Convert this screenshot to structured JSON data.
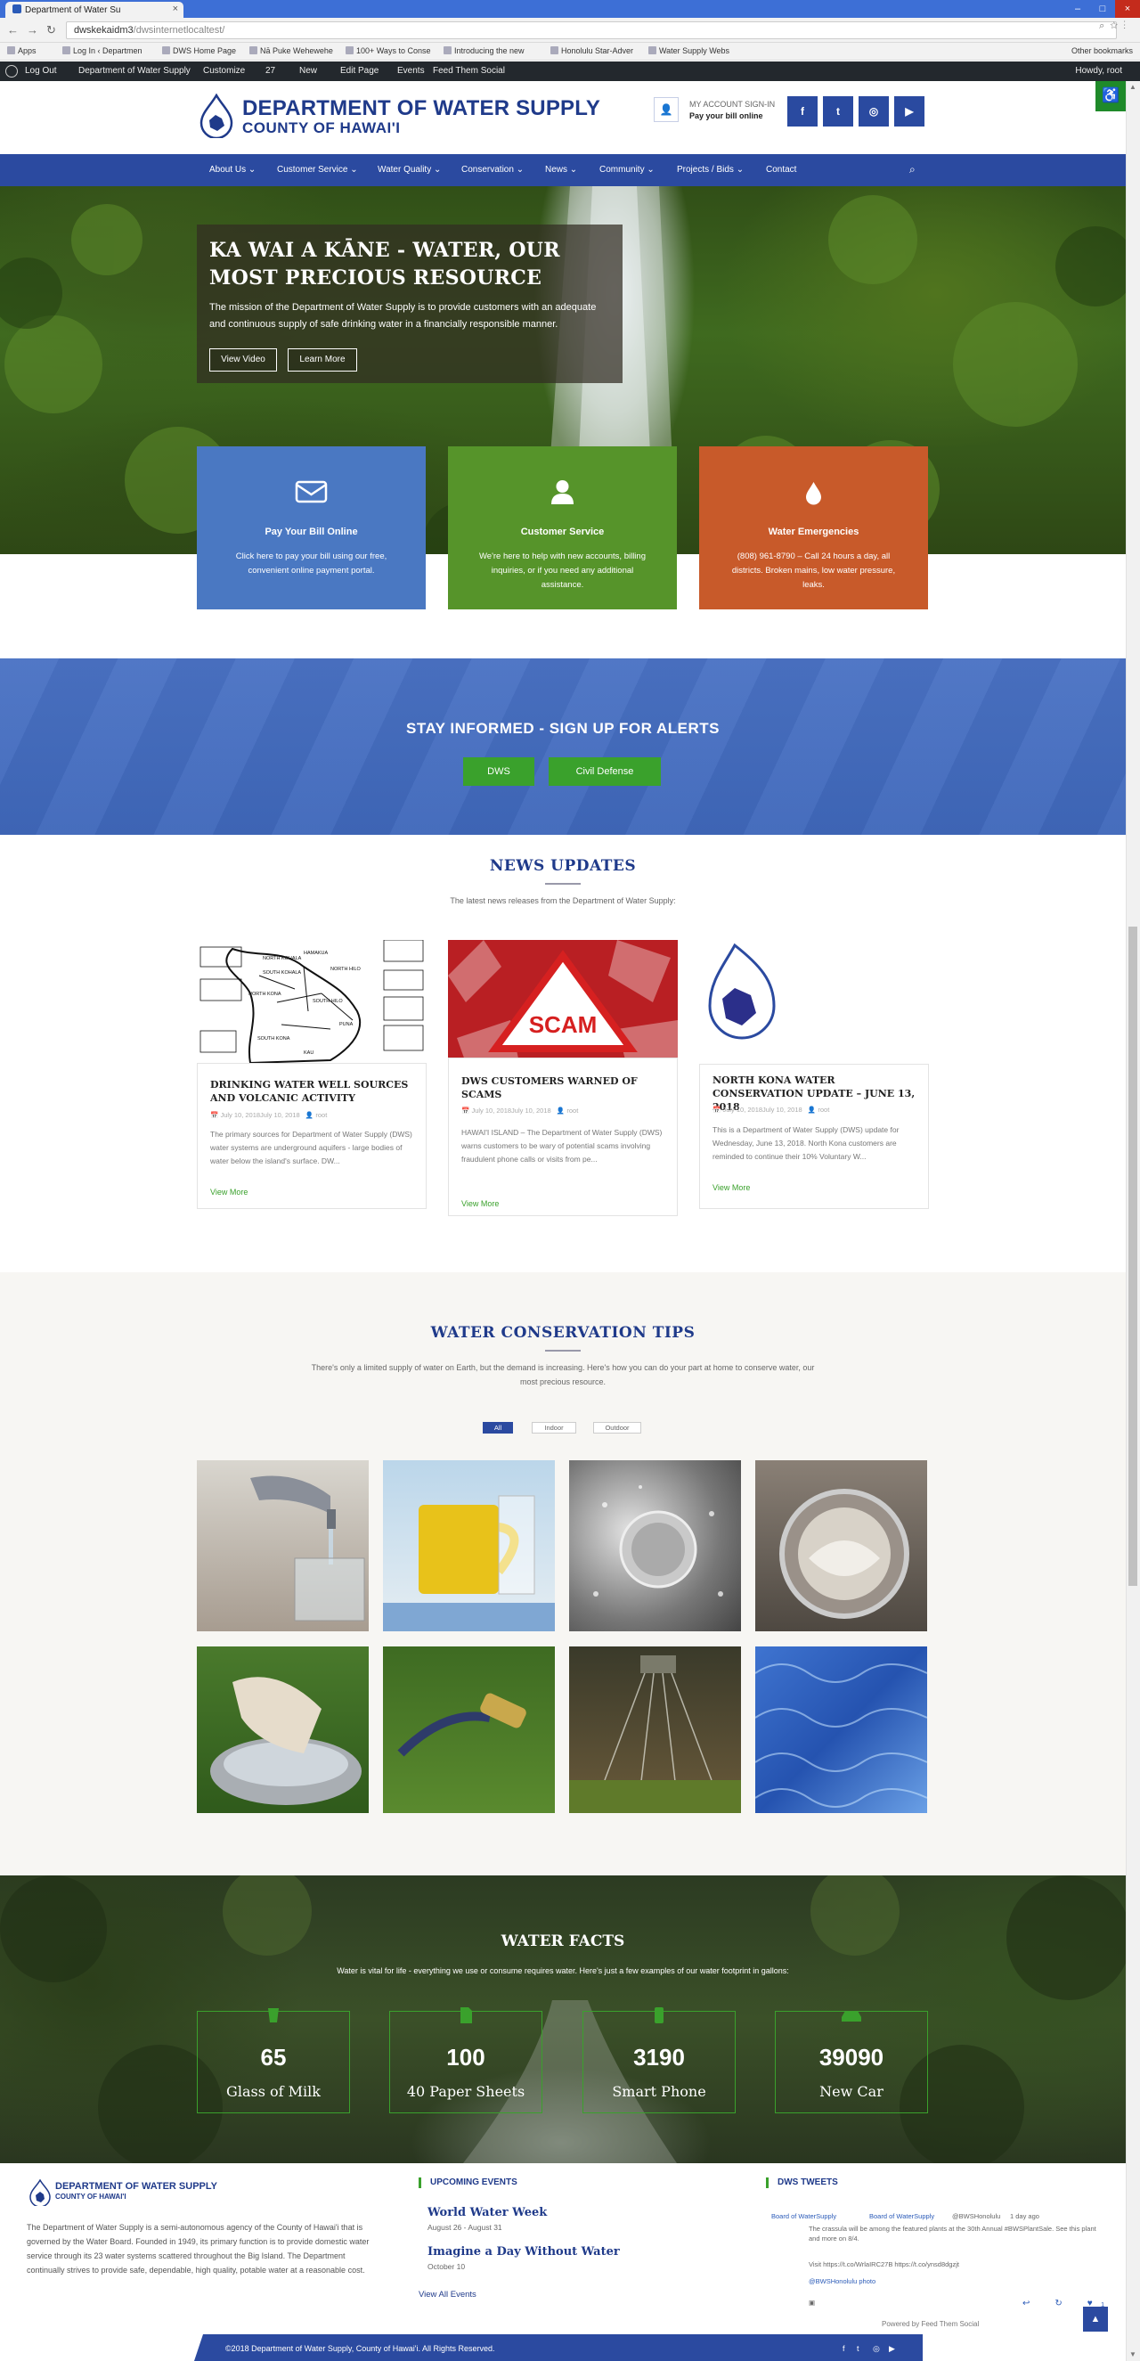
{
  "browser": {
    "tab_title": "Department of Water Su",
    "url_host": "dwskekaidm3",
    "url_path": "/dwsinternetlocaltest/",
    "bookmarks": [
      "Apps",
      "Log In ‹ Departmen",
      "DWS Home Page",
      "Nā Puke Wehewehe",
      "100+ Ways to Conse",
      "Introducing the new",
      "Honolulu Star-Adver",
      "Water Supply Webs"
    ],
    "other_bookmarks": "Other bookmarks"
  },
  "wp_admin": {
    "log_out": "Log Out",
    "site": "Department of Water Supply",
    "customize": "Customize",
    "comments": "27",
    "new": "New",
    "edit_page": "Edit Page",
    "events": "Events",
    "feed": "Feed Them Social",
    "howdy": "Howdy, root"
  },
  "header": {
    "title": "DEPARTMENT OF WATER SUPPLY",
    "subtitle": "COUNTY OF HAWAI'I",
    "account_line1": "MY ACCOUNT SIGN-IN",
    "account_line2": "Pay your bill online",
    "social": [
      "f",
      "t",
      "◎",
      "▶"
    ]
  },
  "nav": {
    "items": [
      "About Us ⌄",
      "Customer Service ⌄",
      "Water Quality ⌄",
      "Conservation ⌄",
      "News ⌄",
      "Community ⌄",
      "Projects / Bids ⌄",
      "Contact"
    ]
  },
  "hero": {
    "title": "KA WAI A KĀNE - WATER, OUR MOST PRECIOUS RESOURCE",
    "text": "The mission of the Department of Water Supply is to provide customers with an adequate and continuous supply of safe drinking water in a financially responsible manner.",
    "btn_video": "View Video",
    "btn_learn": "Learn More"
  },
  "features": [
    {
      "title": "Pay Your Bill Online",
      "text": "Click here to pay your bill using our free, convenient online payment portal.",
      "color": "#4a78c2",
      "icon": "envelope-icon"
    },
    {
      "title": "Customer Service",
      "text": "We're here to help with new accounts, billing inquiries, or if you need any additional assistance.",
      "color": "#56942a",
      "icon": "user-icon"
    },
    {
      "title": "Water Emergencies",
      "text": "(808) 961-8790 – Call 24 hours a day, all districts. Broken mains, low water pressure, leaks.",
      "color": "#c85a2a",
      "icon": "water-drop-icon"
    }
  ],
  "alerts": {
    "title": "STAY INFORMED - SIGN UP FOR ALERTS",
    "btn_dws": "DWS",
    "btn_civil": "Civil Defense"
  },
  "news": {
    "title": "NEWS UPDATES",
    "subtitle": "The latest news releases from the Department of Water Supply:",
    "items": [
      {
        "title": "DRINKING WATER WELL SOURCES AND VOLCANIC ACTIVITY",
        "date": "July 10, 2018July 10, 2018",
        "author": "root",
        "excerpt": "The primary sources for Department of Water Supply (DWS) water systems are underground aquifers - large bodies of water below the island's surface. DW...",
        "more": "View More"
      },
      {
        "title": "DWS CUSTOMERS WARNED OF SCAMS",
        "date": "July 10, 2018July 10, 2018",
        "author": "root",
        "excerpt": "HAWAI'I ISLAND – The Department of Water Supply (DWS) warns customers to be wary of potential scams involving fraudulent phone calls or visits from pe...",
        "more": "View More"
      },
      {
        "title": "NORTH KONA WATER CONSERVATION UPDATE – JUNE 13, 2018",
        "date": "July 10, 2018July 10, 2018",
        "author": "root",
        "excerpt": "This is a Department of Water Supply (DWS) update for Wednesday, June 13, 2018. North Kona customers are reminded to continue their 10% Voluntary W...",
        "more": "View More"
      }
    ],
    "map_labels": [
      "NORTH KOHALA",
      "SOUTH KOHALA",
      "HAMAKUA",
      "NORTH KONA",
      "SOUTH KONA",
      "NORTH HILO",
      "SOUTH HILO",
      "PUNA",
      "KAU"
    ],
    "scam_word": "SCAM"
  },
  "conservation": {
    "title": "WATER CONSERVATION TIPS",
    "subtitle": "There's only a limited supply of water on Earth, but the demand is increasing. Here's how you can do your part at home to conserve water, our most precious resource.",
    "filters": [
      "All",
      "Indoor",
      "Outdoor"
    ]
  },
  "facts": {
    "title": "WATER FACTS",
    "subtitle": "Water is vital for life - everything we use or consume requires water. Here's just a few examples of our water footprint in gallons:",
    "items": [
      {
        "num": "65",
        "label": "Glass of Milk",
        "icon": "glass-icon"
      },
      {
        "num": "100",
        "label": "40 Paper Sheets",
        "icon": "paper-icon"
      },
      {
        "num": "3190",
        "label": "Smart Phone",
        "icon": "phone-icon"
      },
      {
        "num": "39090",
        "label": "New Car",
        "icon": "car-icon"
      }
    ]
  },
  "footer": {
    "logo_title": "DEPARTMENT OF WATER SUPPLY",
    "logo_sub": "COUNTY OF HAWAI'I",
    "about": "The Department of Water Supply is a semi-autonomous agency of the County of Hawai'i that is governed by the Water Board. Founded in 1949, its primary function is to provide domestic water service through its 23 water systems scattered throughout the Big Island. The Department continually strives to provide safe, dependable, high quality, potable water at a reasonable cost.",
    "events_head": "UPCOMING EVENTS",
    "events": [
      {
        "title": "World Water Week",
        "date": "August 26 - August 31"
      },
      {
        "title": "Imagine a Day Without Water",
        "date": "October 10"
      }
    ],
    "events_all": "View All Events",
    "tweets_head": "DWS TWEETS",
    "tweet_img_alt": "Board of WaterSupply",
    "tweet_name": "Board of WaterSupply",
    "tweet_handle": "@BWSHonolulu",
    "tweet_time": "1 day ago",
    "tweet_text1": "The crassula will be among the featured plants at the 30th Annual #BWSPlantSale. See this plant",
    "tweet_text2": "and more on 8/4.",
    "tweet_text3": "Visit https://t.co/WrlaIRC27B https://t.co/ynsd8dgzjt",
    "tweet_photo": "@BWSHonolulu photo",
    "like_count": "1",
    "powered": "Powered by Feed Them Social",
    "copyright": "©2018 Department of Water Supply, County of Hawai'i. All Rights Reserved.",
    "bottom_social": [
      "f",
      "t",
      "◎",
      "▶"
    ]
  }
}
